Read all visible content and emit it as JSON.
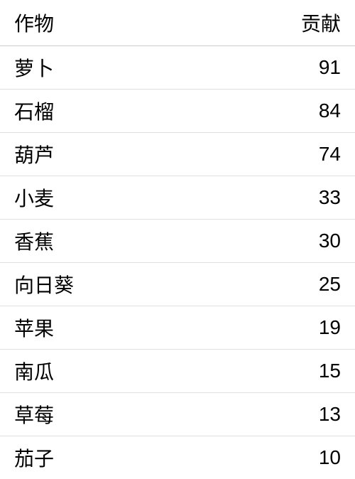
{
  "table": {
    "headers": {
      "crop": "作物",
      "contribution": "贡献"
    },
    "rows": [
      {
        "crop": "萝卜",
        "value": "91"
      },
      {
        "crop": "石榴",
        "value": "84"
      },
      {
        "crop": "葫芦",
        "value": "74"
      },
      {
        "crop": "小麦",
        "value": "33"
      },
      {
        "crop": "香蕉",
        "value": "30"
      },
      {
        "crop": "向日葵",
        "value": "25"
      },
      {
        "crop": "苹果",
        "value": "19"
      },
      {
        "crop": "南瓜",
        "value": "15"
      },
      {
        "crop": "草莓",
        "value": "13"
      },
      {
        "crop": "茄子",
        "value": "10"
      }
    ]
  }
}
